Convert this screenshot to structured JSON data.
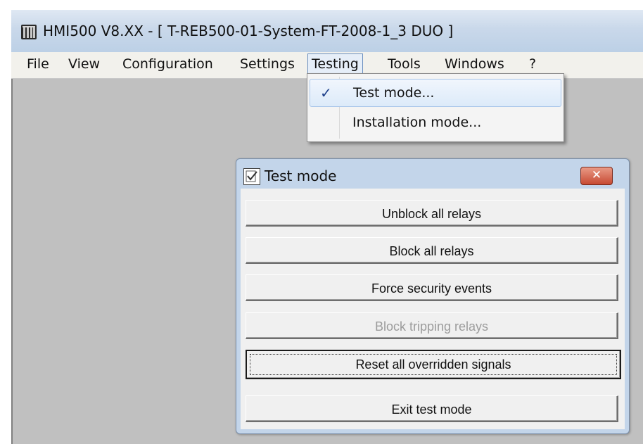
{
  "window": {
    "title": "HMI500 V8.XX - [ T-REB500-01-System-FT-2008-1_3 DUO ]",
    "icon": "app-icon"
  },
  "menubar": {
    "items": [
      {
        "label": "File"
      },
      {
        "label": "View"
      },
      {
        "label": "Configuration"
      },
      {
        "label": "Settings"
      },
      {
        "label": "Testing",
        "active": true
      },
      {
        "label": "Tools"
      },
      {
        "label": "Windows"
      },
      {
        "label": "?"
      }
    ]
  },
  "testing_menu": {
    "items": [
      {
        "label": "Test mode...",
        "checked": true,
        "check_glyph": "✓"
      },
      {
        "label": "Installation mode...",
        "checked": false
      }
    ]
  },
  "test_dialog": {
    "title": "Test mode",
    "icon": "checklist-icon",
    "close_glyph": "✕",
    "buttons": [
      {
        "label": "Unblock all relays",
        "enabled": true
      },
      {
        "label": "Block all relays",
        "enabled": true
      },
      {
        "label": "Force security events",
        "enabled": true
      },
      {
        "label": "Block tripping relays",
        "enabled": false
      },
      {
        "label": "Reset all overridden signals",
        "enabled": true,
        "focused": true
      },
      {
        "label": "Exit test mode",
        "enabled": true
      }
    ]
  },
  "colors": {
    "titlebar": "#c9d8ea",
    "client_background": "#c0c0c0",
    "dialog_frame": "#c3d5ea",
    "close_button": "#c74a33",
    "disabled_text": "#9c9c9c"
  }
}
